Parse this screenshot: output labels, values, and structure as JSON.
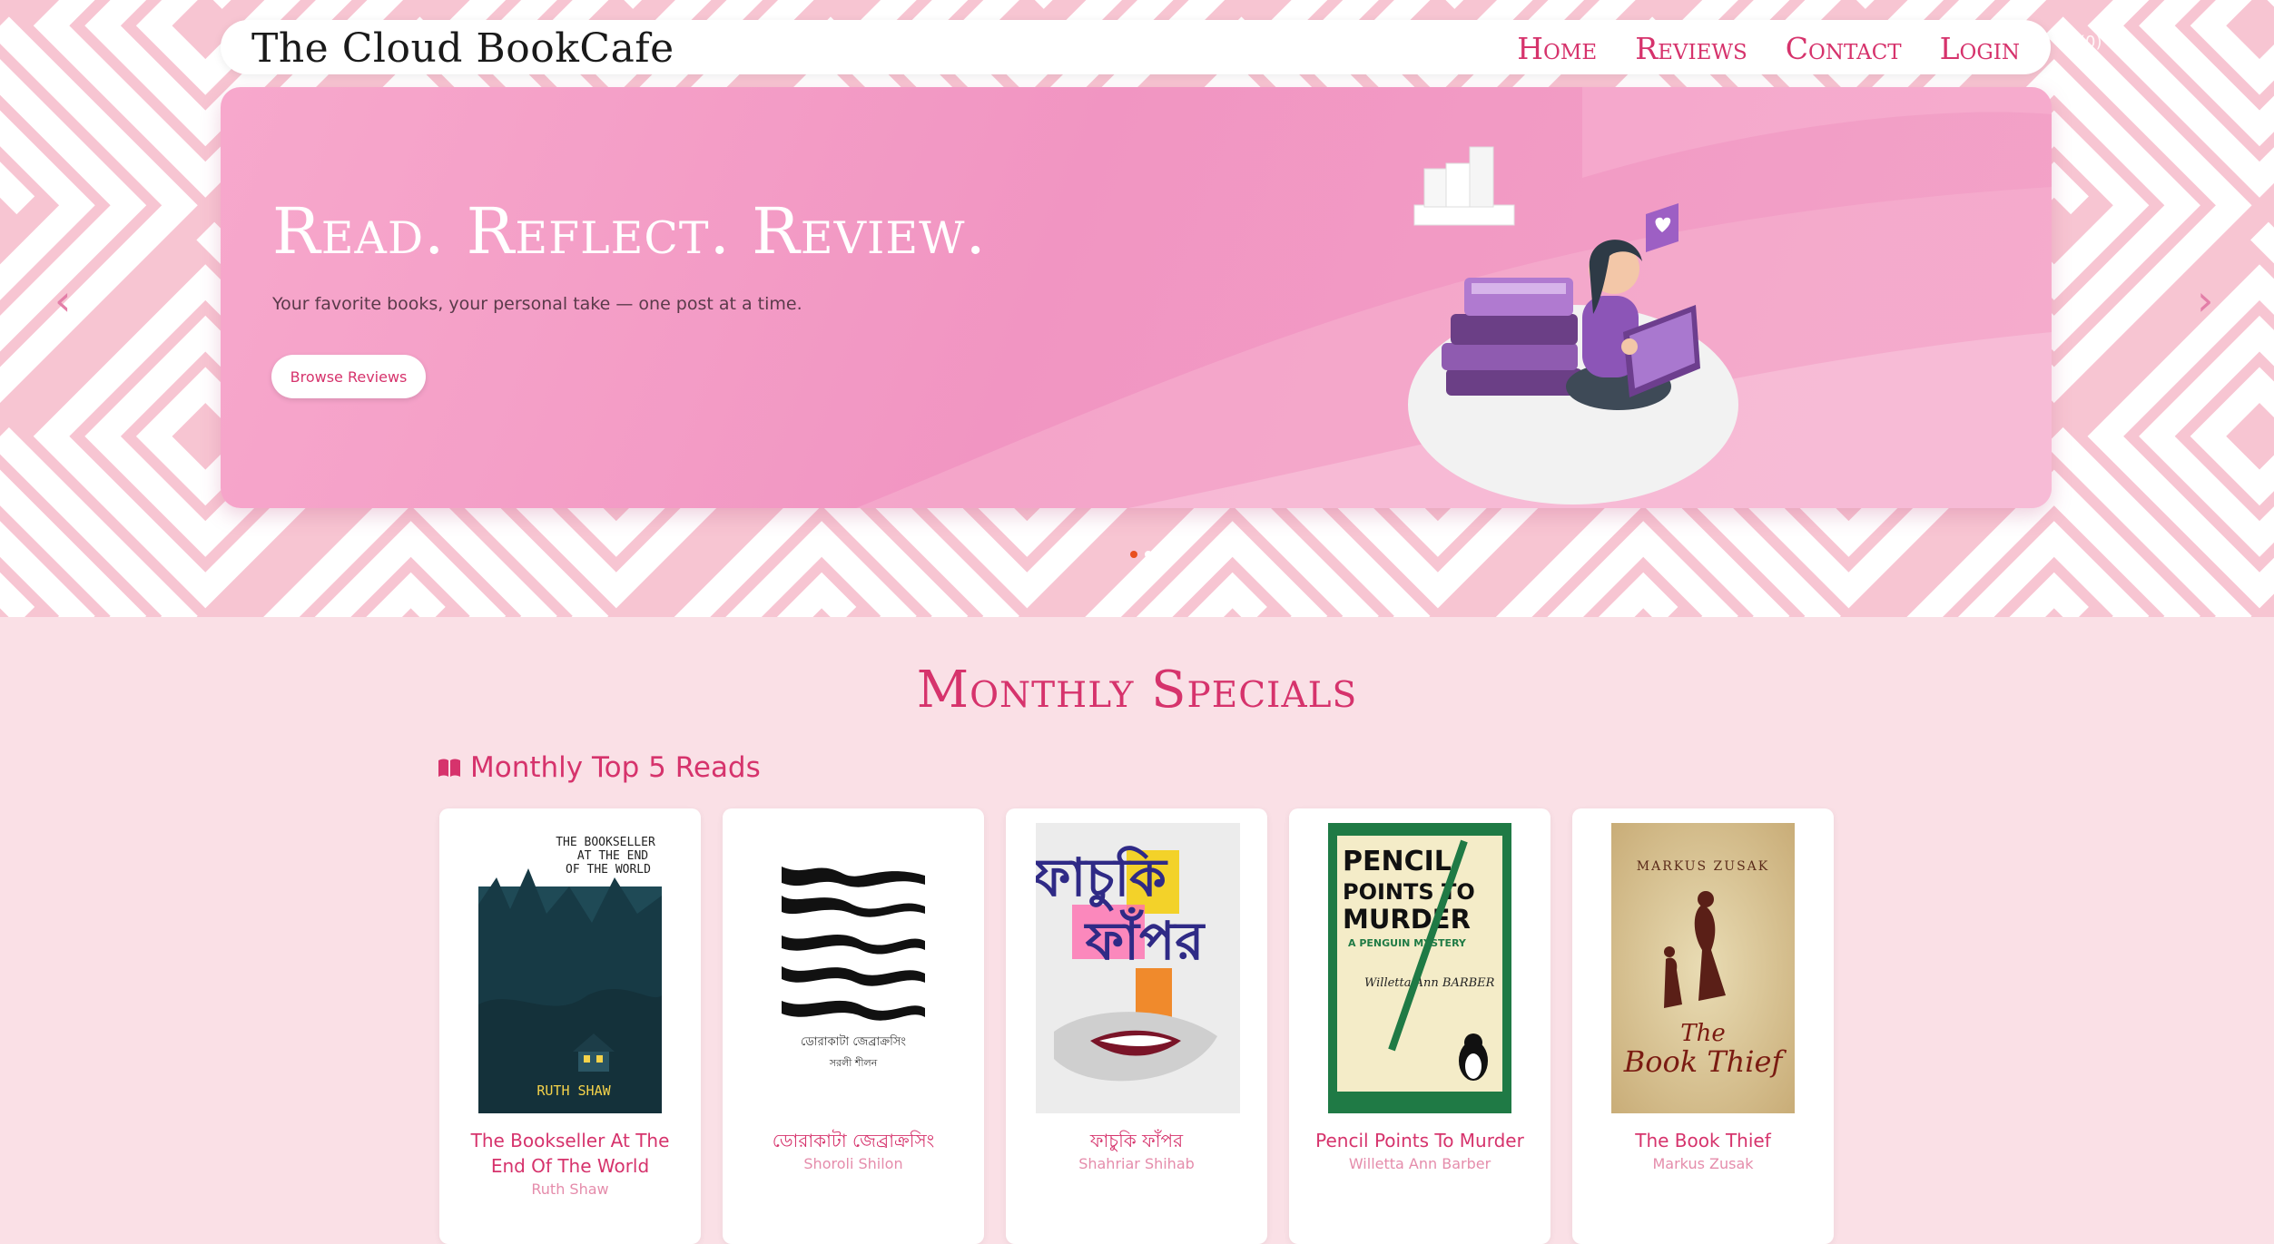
{
  "navbar": {
    "brand": "The Cloud BookCafe",
    "links": [
      "Home",
      "Reviews",
      "Contact",
      "Login"
    ],
    "cart_hint": "(0)"
  },
  "hero": {
    "title": "Read. Reflect. Review.",
    "subtitle": "Your favorite books, your personal take — one post at a time.",
    "button_label": "Browse Reviews",
    "prev_label": "‹",
    "next_label": "›",
    "active_slide": 1,
    "slide_count": 2
  },
  "specials": {
    "title": "Monthly Specials",
    "subheading": "Monthly Top 5 Reads",
    "books": [
      {
        "title": "The Bookseller At The End Of The World",
        "author": "Ruth Shaw",
        "cover_text": [
          "THE BOOKSELLER",
          "AT THE END",
          "OF THE WORLD"
        ],
        "cover_author": "RUTH SHAW",
        "cover_color": "#1f4a56"
      },
      {
        "title": "ডোরাকাটা জেব্রাক্রসিং",
        "author": "Shoroli Shilon",
        "cover_text": [
          "ডোরাকাটা জেব্রাক্রসিং"
        ],
        "cover_author": "সরলী শীলন",
        "cover_color": "#ffffff"
      },
      {
        "title": "ফাচুকি ফাঁপর",
        "author": "Shahriar Shihab",
        "cover_text": [
          "ফাচুকি",
          "ফাঁপর"
        ],
        "cover_author": "",
        "cover_color": "#eeeeee"
      },
      {
        "title": "Pencil Points To Murder",
        "author": "Willetta Ann Barber",
        "cover_text": [
          "PENCIL",
          "POINTS TO",
          "MURDER",
          "A PENGUIN MYSTERY"
        ],
        "cover_author": "Willetta Ann BARBER",
        "cover_color": "#1f7a45"
      },
      {
        "title": "The Book Thief",
        "author": "Markus Zusak",
        "cover_text": [
          "The",
          "Book Thief"
        ],
        "cover_author": "MARKUS ZUSAK",
        "cover_color": "#d6c39a"
      }
    ]
  }
}
